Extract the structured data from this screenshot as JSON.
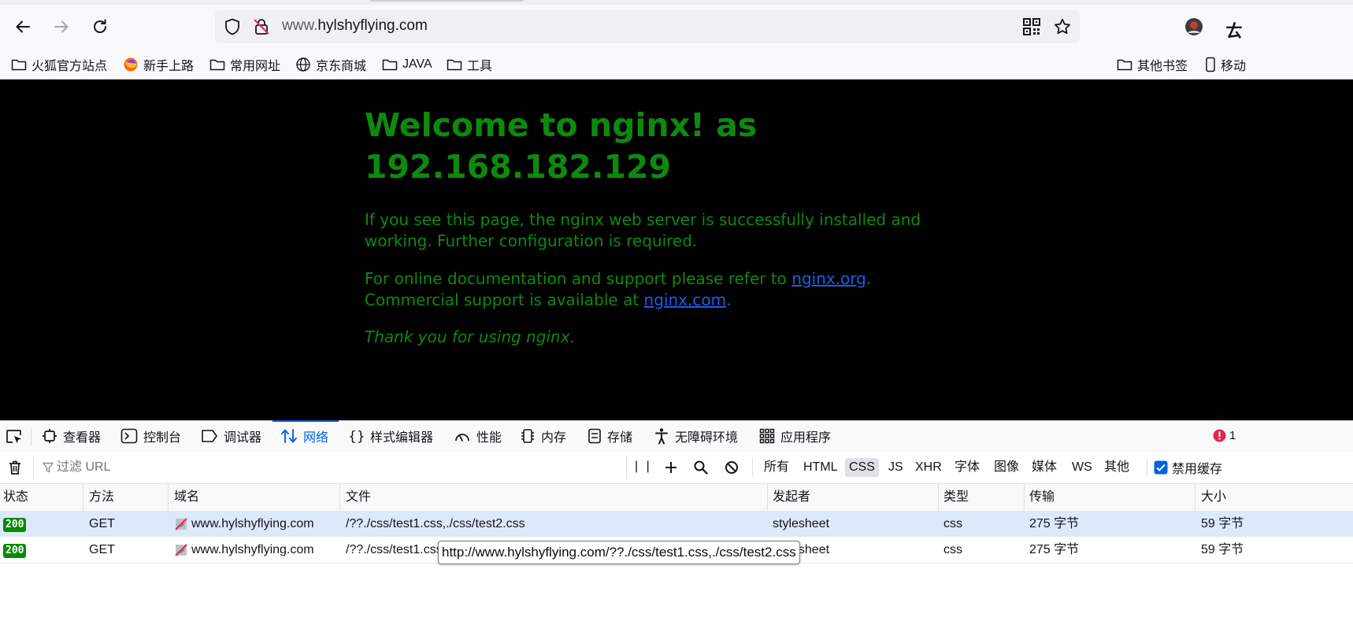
{
  "browser": {
    "url_prefix": "www.",
    "url_domain": "hylshyflying.com",
    "bookmarks": [
      {
        "label": "火狐官方站点",
        "icon": "folder-icon"
      },
      {
        "label": "新手上路",
        "icon": "firefox-icon"
      },
      {
        "label": "常用网址",
        "icon": "folder-icon"
      },
      {
        "label": "京东商城",
        "icon": "globe-icon"
      },
      {
        "label": "JAVA",
        "icon": "folder-icon"
      },
      {
        "label": "工具",
        "icon": "folder-icon"
      }
    ],
    "other_bookmarks": "其他书签",
    "mobile_bookmarks": "移动"
  },
  "page": {
    "title": "Welcome to nginx! as 192.168.182.129",
    "p1": "If you see this page, the nginx web server is successfully installed and working. Further configuration is required.",
    "p2_a": "For online documentation and support please refer to ",
    "p2_link1": "nginx.org",
    "p2_b": ".",
    "p2_c": "Commercial support is available at ",
    "p2_link2": "nginx.com",
    "p2_d": ".",
    "p3": "Thank you for using nginx."
  },
  "devtools": {
    "tabs": [
      {
        "label": "查看器",
        "icon": "inspector-icon"
      },
      {
        "label": "控制台",
        "icon": "console-icon"
      },
      {
        "label": "调试器",
        "icon": "debugger-icon"
      },
      {
        "label": "网络",
        "icon": "network-icon",
        "active": true
      },
      {
        "label": "样式编辑器",
        "icon": "braces-icon"
      },
      {
        "label": "性能",
        "icon": "gauge-icon"
      },
      {
        "label": "内存",
        "icon": "memory-icon"
      },
      {
        "label": "存储",
        "icon": "storage-icon"
      },
      {
        "label": "无障碍环境",
        "icon": "accessibility-icon"
      },
      {
        "label": "应用程序",
        "icon": "apps-grid-icon"
      }
    ],
    "error_count": "1",
    "filter_placeholder": "过滤 URL",
    "type_filters": [
      "所有",
      "HTML",
      "CSS",
      "JS",
      "XHR",
      "字体",
      "图像",
      "媒体",
      "WS",
      "其他"
    ],
    "selected_filter": "CSS",
    "disable_cache_label": "禁用缓存",
    "disable_cache_checked": true,
    "columns": [
      "状态",
      "方法",
      "域名",
      "文件",
      "发起者",
      "类型",
      "传输",
      "大小"
    ],
    "rows": [
      {
        "status": "200",
        "method": "GET",
        "domain": "www.hylshyflying.com",
        "file": "/??./css/test1.css,./css/test2.css",
        "initiator": "stylesheet",
        "type": "css",
        "transfer": "275 字节",
        "size": "59 字节"
      },
      {
        "status": "200",
        "method": "GET",
        "domain": "www.hylshyflying.com",
        "file": "/??./css/test1.css,./css/test2.css",
        "initiator": "stylesheet",
        "type": "css",
        "transfer": "275 字节",
        "size": "59 字节"
      }
    ],
    "tooltip": "http://www.hylshyflying.com/??./css/test1.css,./css/test2.css"
  },
  "colors": {
    "nginx_text": "#0d8a0d",
    "page_bg": "#000000",
    "link": "#1a5ee6",
    "accent": "#0060df",
    "status_ok": "#058b00",
    "selected_row": "#dbe9fb"
  }
}
